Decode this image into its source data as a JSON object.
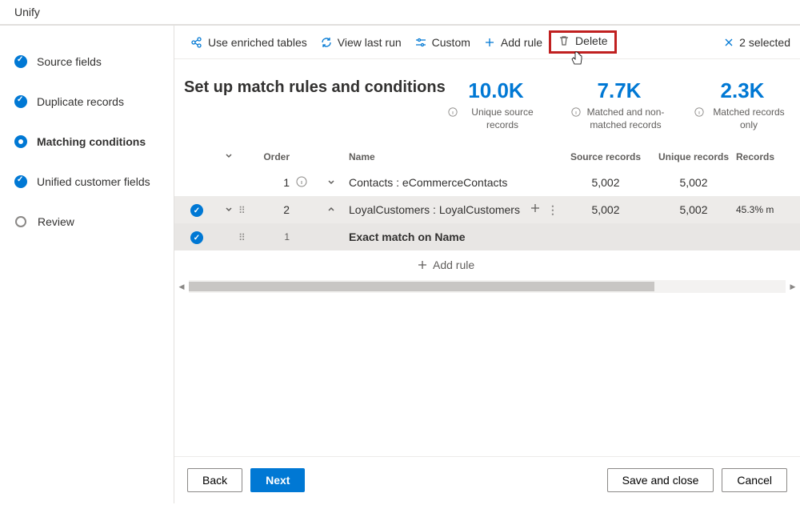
{
  "header": {
    "app_title": "Unify"
  },
  "sidebar": {
    "steps": [
      {
        "label": "Source fields",
        "state": "done"
      },
      {
        "label": "Duplicate records",
        "state": "done"
      },
      {
        "label": "Matching conditions",
        "state": "active"
      },
      {
        "label": "Unified customer fields",
        "state": "done"
      },
      {
        "label": "Review",
        "state": "pending"
      }
    ]
  },
  "toolbar": {
    "use_enriched": "Use enriched tables",
    "view_last_run": "View last run",
    "custom": "Custom",
    "add_rule": "Add rule",
    "delete": "Delete",
    "selected_count": "2 selected"
  },
  "page": {
    "title": "Set up match rules and conditions"
  },
  "stats": {
    "unique_source": {
      "value": "10.0K",
      "label": "Unique source records"
    },
    "matched": {
      "value": "7.7K",
      "label": "Matched and non-matched records"
    },
    "matched_only": {
      "value": "2.3K",
      "label": "Matched records only"
    }
  },
  "table": {
    "col_order": "Order",
    "col_name": "Name",
    "col_source": "Source records",
    "col_unique": "Unique records",
    "col_records": "Records",
    "rows": [
      {
        "checked": false,
        "order": "1",
        "info": true,
        "expand": "down",
        "name": "Contacts : eCommerceContacts",
        "source": "5,002",
        "unique": "5,002",
        "pct": ""
      },
      {
        "checked": true,
        "order": "2",
        "info": false,
        "expand": "up",
        "name": "LoyalCustomers : LoyalCustomers",
        "source": "5,002",
        "unique": "5,002",
        "pct": "45.3% m",
        "action": true
      }
    ],
    "sub_rule": {
      "order": "1",
      "label": "Exact match on Name"
    },
    "add_rule_label": "Add rule"
  },
  "footer": {
    "back": "Back",
    "next": "Next",
    "save_close": "Save and close",
    "cancel": "Cancel"
  }
}
